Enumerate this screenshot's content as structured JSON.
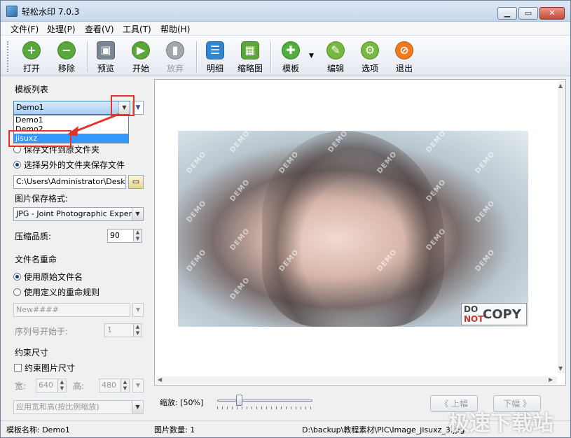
{
  "app": {
    "title": "轻松水印 7.0.3"
  },
  "menu": [
    "文件(F)",
    "处理(P)",
    "查看(V)",
    "工具(T)",
    "帮助(H)"
  ],
  "toolbar": {
    "open": "打开",
    "remove": "移除",
    "preview": "预览",
    "start": "开始",
    "abandon": "放弃",
    "detail": "明细",
    "thumbnail": "缩略图",
    "template": "模板",
    "edit": "编辑",
    "options": "选项",
    "exit": "退出"
  },
  "left": {
    "template_list_label": "模板列表",
    "template_selected": "Demo1",
    "template_options": [
      "Demo1",
      "Demo2",
      "jisuxz"
    ],
    "save_original": "保存文件到原文件夹",
    "save_other": "选择另外的文件夹保存文件",
    "save_path": "C:\\Users\\Administrator\\Desktop\\",
    "format_label": "图片保存格式:",
    "format_value": "JPG - Joint Photographic Experts G",
    "quality_label": "压缩品质:",
    "quality_value": "90",
    "rename_label": "文件名重命",
    "rename_original": "使用原始文件名",
    "rename_custom": "使用定义的重命规则",
    "rename_pattern": "New####",
    "seq_label": "序列号开始于:",
    "seq_value": "1",
    "constrain_label": "约束尺寸",
    "constrain_check": "约束图片尺寸",
    "width_label": "宽:",
    "width_value": "640",
    "height_label": "高:",
    "height_value": "480",
    "scale_mode": "应用宽和高(按比例缩放)"
  },
  "preview": {
    "watermark_text": "DEMO",
    "dnc_do": "DO",
    "dnc_not": "NOT",
    "dnc_copy": "COPY",
    "zoom_label": "缩放: [50%]",
    "zoom_percent": 50,
    "prev": "上幅",
    "next": "下幅"
  },
  "status": {
    "template_name": "模板名称:  Demo1",
    "image_count": "图片数量:   1",
    "file_path": "D:\\backup\\教程素材\\PIC\\Image_jisuxz_3.jpg"
  },
  "site_watermark": "极速下载站",
  "colors": {
    "annotation": "#e5322d",
    "selection": "#3399ff"
  }
}
